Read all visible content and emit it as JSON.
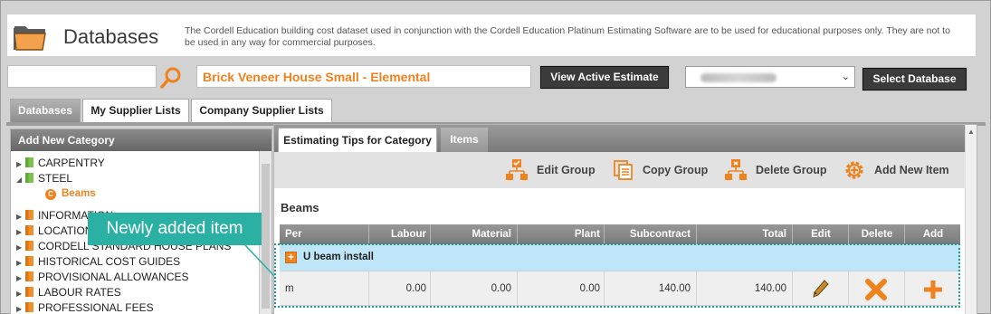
{
  "header": {
    "title": "Databases",
    "disclaimer": "The Cordell Education building cost dataset used in conjunction with the Cordell Education Platinum Estimating Software are to be used for educational purposes only. They are not to be used in any way for commercial purposes."
  },
  "search": {
    "value": "",
    "placeholder": ""
  },
  "estimate": {
    "name": "Brick Veneer House Small - Elemental",
    "view_button": "View Active Estimate"
  },
  "database_select": {
    "select_button": "Select Database"
  },
  "tabs": [
    {
      "label": "Databases"
    },
    {
      "label": "My Supplier Lists"
    },
    {
      "label": "Company Supplier Lists"
    }
  ],
  "left_panel": {
    "header": "Add New Category",
    "tree": [
      {
        "label": "CARPENTRY"
      },
      {
        "label": "STEEL"
      },
      {
        "label": "Beams"
      },
      {
        "label": "INFORMATION"
      },
      {
        "label": "LOCATION"
      },
      {
        "label": "CORDELL STANDARD HOUSE PLANS"
      },
      {
        "label": "HISTORICAL COST GUIDES"
      },
      {
        "label": "PROVISIONAL ALLOWANCES"
      },
      {
        "label": "LABOUR RATES"
      },
      {
        "label": "PROFESSIONAL FEES"
      }
    ]
  },
  "right_panel": {
    "tabs": [
      {
        "label": "Estimating Tips for Category"
      },
      {
        "label": "Items"
      }
    ],
    "toolbar": {
      "edit_group": "Edit Group",
      "copy_group": "Copy Group",
      "delete_group": "Delete Group",
      "add_new_item": "Add New Item"
    },
    "section_title": "Beams",
    "columns": [
      "Per",
      "Labour",
      "Material",
      "Plant",
      "Subcontract",
      "Total",
      "Edit",
      "Delete",
      "Add"
    ],
    "group": {
      "label": "U beam install"
    },
    "row": {
      "per": "m",
      "labour": "0.00",
      "material": "0.00",
      "plant": "0.00",
      "subcontract": "140.00",
      "total": "140.00"
    }
  },
  "callout": {
    "text": "Newly added item"
  },
  "colors": {
    "accent_orange": "#f0821e",
    "highlight_teal": "#2bb1a4",
    "group_row_blue": "#bfe6f8"
  }
}
